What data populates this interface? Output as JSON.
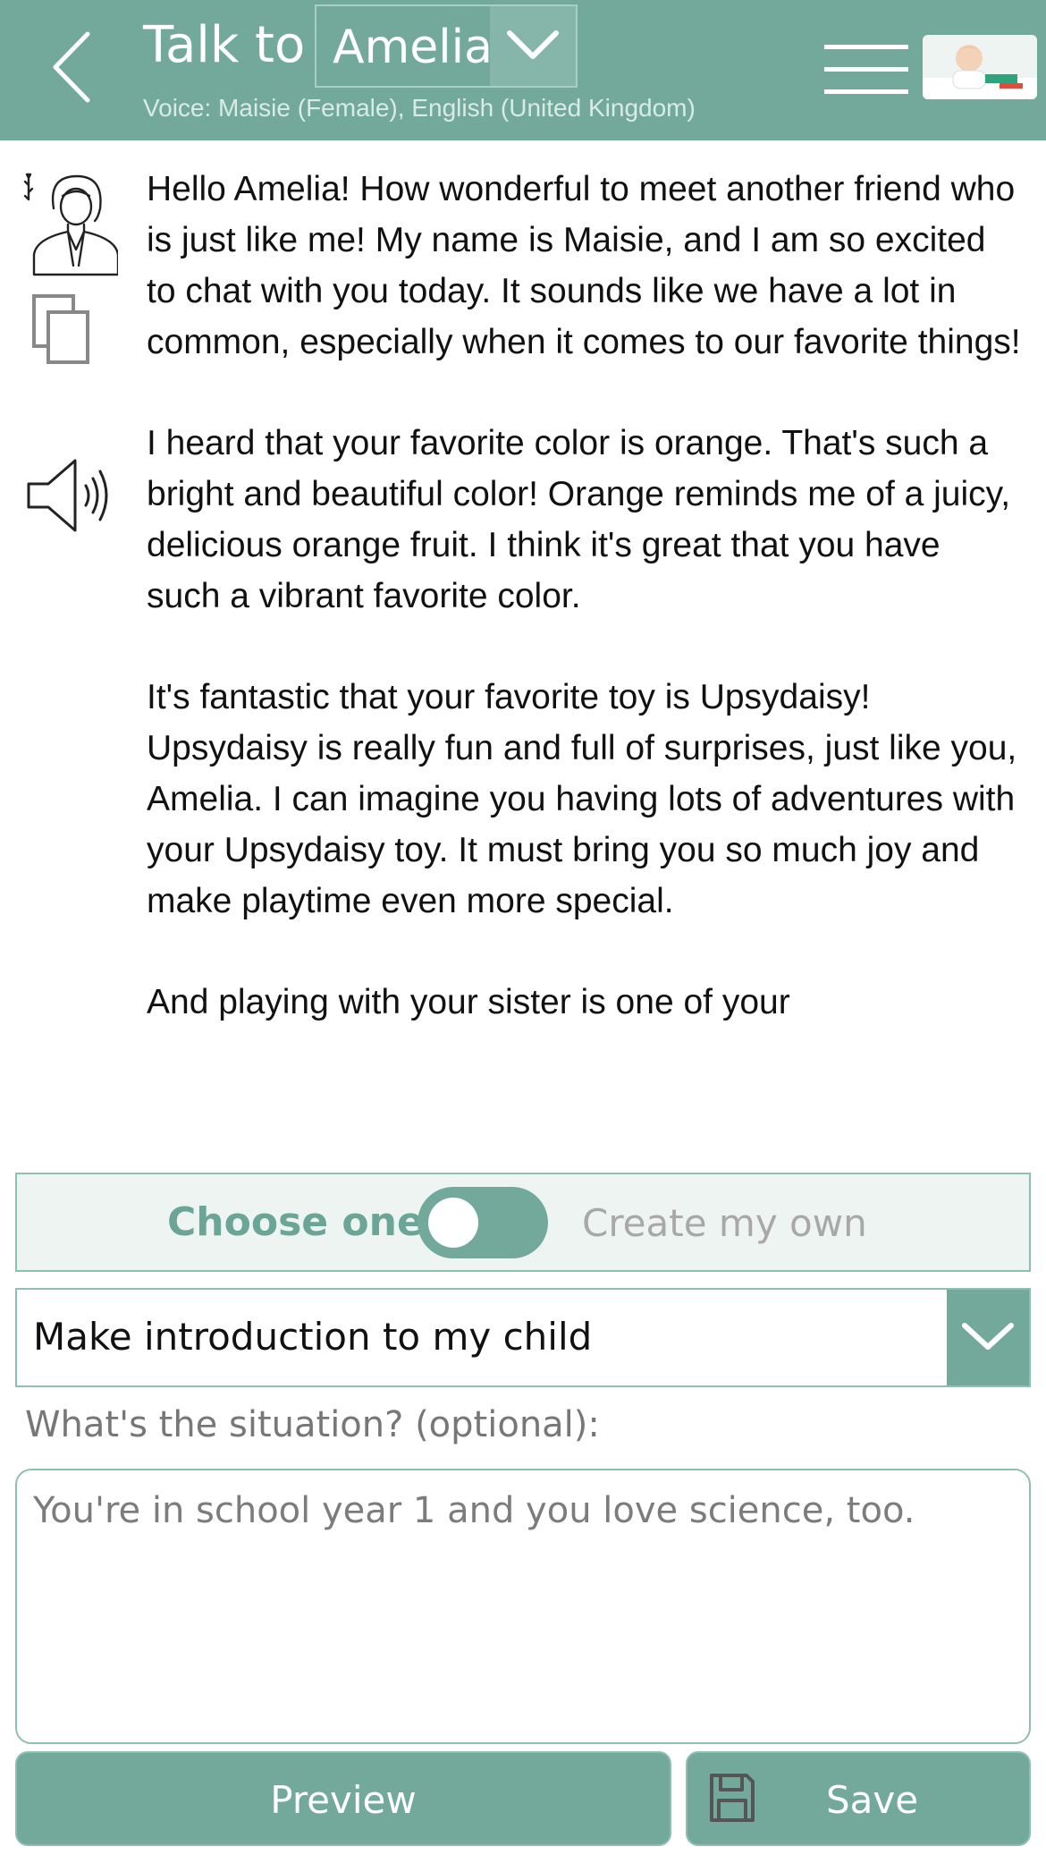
{
  "header": {
    "talk_to_label": "Talk to",
    "child_name": "Amelia",
    "voice_line": "Voice: Maisie (Female), English (United Kingdom)"
  },
  "message": {
    "paragraphs": [
      "Hello Amelia! How wonderful to meet another friend who is just like me! My name is Maisie, and I am so excited to chat with you today. It sounds like we have a lot in common, especially when it comes to our favorite things!",
      "I heard that your favorite color is orange. That's such a bright and beautiful color! Orange reminds me of a juicy, delicious orange fruit. I think it's great that you have such a vibrant favorite color.",
      "It's fantastic that your favorite toy is Upsydaisy! Upsydaisy is really fun and full of surprises, just like you, Amelia. I can imagine you having lots of adventures with your Upsydaisy toy. It must bring you so much joy and make playtime even more special.",
      "And playing with your sister is one of your"
    ]
  },
  "mode_toggle": {
    "left_label": "Choose one",
    "right_label": "Create my own"
  },
  "prompt_select": {
    "selected": "Make introduction to my child"
  },
  "situation": {
    "label": "What's the situation? (optional):",
    "placeholder": "You're in school year 1 and you love science, too."
  },
  "buttons": {
    "preview_label": "Preview",
    "save_label": "Save"
  },
  "icons": {
    "back": "chevron-left-icon",
    "dropdown": "chevron-down-icon",
    "menu": "hamburger-menu-icon",
    "persona": "woman-avatar-icon",
    "copy": "copy-icon",
    "speaker": "speaker-icon",
    "save": "floppy-disk-icon"
  },
  "colors": {
    "primary": "#73a99b",
    "panel_bg": "#eef4f2",
    "border": "#8fbfb2"
  }
}
